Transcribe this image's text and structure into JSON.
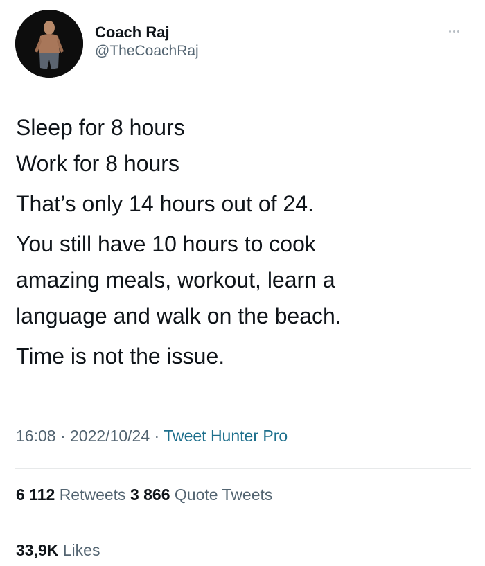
{
  "author": {
    "display_name": "Coach Raj",
    "handle": "@TheCoachRaj",
    "avatar_icon": "person-silhouette"
  },
  "tweet": {
    "paragraphs": [
      [
        "Sleep for 8 hours",
        "Work for 8 hours"
      ],
      [
        "That’s only 14 hours out of 24."
      ],
      [
        "You still have 10 hours to cook",
        "amazing meals, workout, learn a",
        "language and walk on the beach."
      ],
      [
        "Time is not the issue."
      ]
    ]
  },
  "meta": {
    "time": "16:08",
    "separator": "·",
    "date": "2022/10/24",
    "source": "Tweet Hunter Pro"
  },
  "stats": {
    "retweets_count": "6 112",
    "retweets_label": "Retweets",
    "quotes_count": "3 866",
    "quotes_label": "Quote Tweets",
    "likes_count": "33,9K",
    "likes_label": "Likes"
  },
  "colors": {
    "text": "#0f1419",
    "secondary": "#536471",
    "source_link": "#1d6f8c",
    "divider": "#e7e9ea"
  }
}
